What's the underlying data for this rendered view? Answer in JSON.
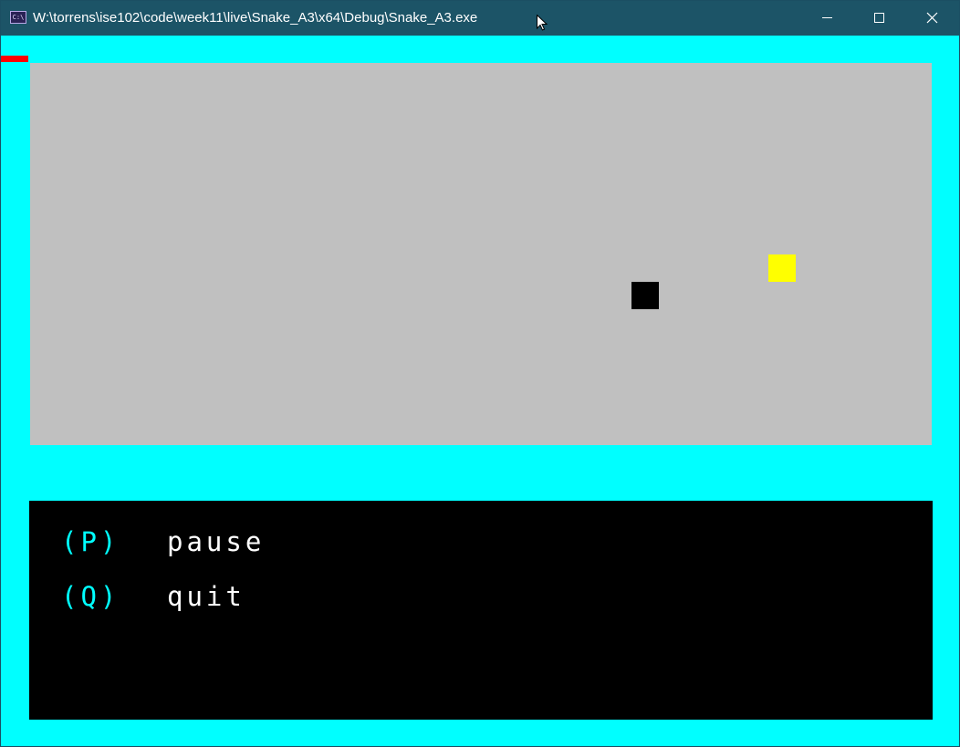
{
  "window": {
    "title": "W:\\torrens\\ise102\\code\\week11\\live\\Snake_A3\\x64\\Debug\\Snake_A3.exe",
    "icon": "console-app-icon",
    "icon_glyph": "C:\\",
    "controls": {
      "minimize": "minimize-icon",
      "maximize": "maximize-icon",
      "close": "close-icon"
    }
  },
  "colors": {
    "background": "#00ffff",
    "titlebar": "#1c5467",
    "playfield": "#c0c0c0",
    "snake": "#000000",
    "food": "#ffff00",
    "marker": "#ff0000",
    "menu_background": "#000000",
    "menu_key": "#00ffff",
    "menu_label": "#ffffff"
  },
  "game": {
    "snake_segments": 1,
    "food_items": 1
  },
  "menu": {
    "items": [
      {
        "key": "(P)",
        "label": "pause"
      },
      {
        "key": "(Q)",
        "label": "quit"
      }
    ]
  }
}
